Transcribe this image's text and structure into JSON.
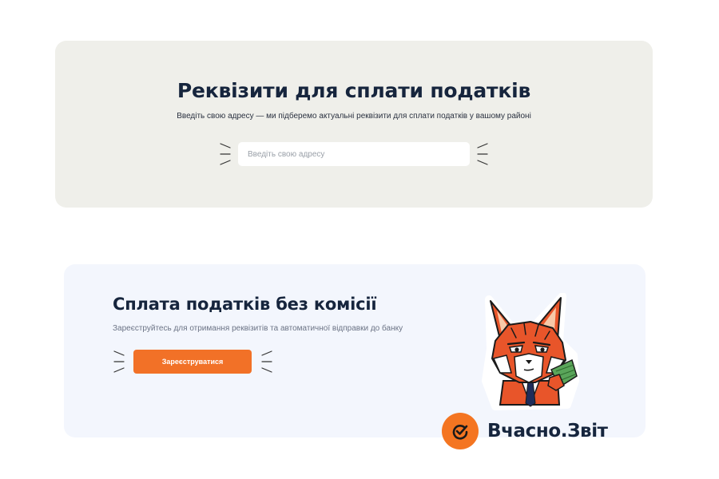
{
  "address_section": {
    "title": "Реквізити для сплати податків",
    "subtitle": "Введіть свою адресу — ми підберемо актуальні реквізити для сплати податків у вашому районі",
    "address_input": {
      "placeholder": "Введіть свою адресу",
      "value": ""
    }
  },
  "promo_section": {
    "title": "Сплата податків без комісії",
    "subtitle": "Зареєструйтесь для отримання реквізитів та автоматичної відправки до банку",
    "register_button_label": "Зареєструватися"
  },
  "brand": {
    "name": "Вчасно.Звіт",
    "icon": "check-circle-icon",
    "color": "#f47521"
  },
  "mascot": {
    "icon": "fox-mascot"
  },
  "colors": {
    "accent_button": "#f27127",
    "card_gray": "#efefea",
    "card_blue": "#f3f6fd",
    "heading": "#16253d"
  }
}
